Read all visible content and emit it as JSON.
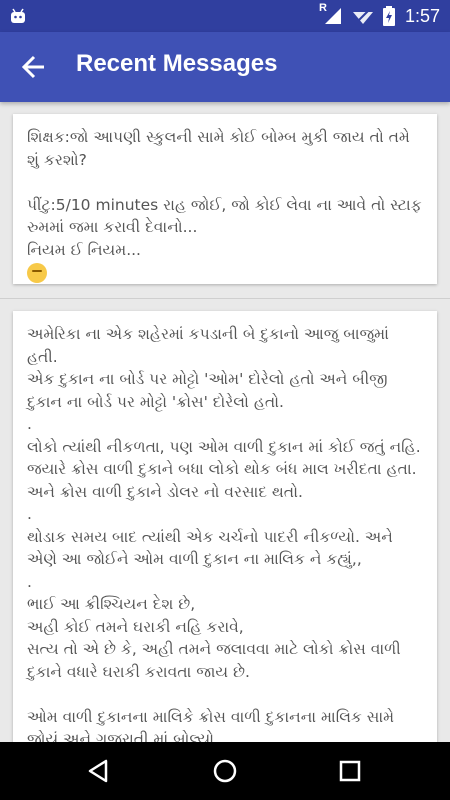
{
  "status_bar": {
    "time": "1:57",
    "roaming_indicator": "R",
    "icons": [
      "android-icon",
      "wifi-icon",
      "signal-icon",
      "battery-charging-icon"
    ]
  },
  "app_bar": {
    "title": "Recent Messages",
    "back_icon": "arrow-back-icon",
    "color": "#3f51b5",
    "status_color": "#303f9f"
  },
  "messages": [
    {
      "text": "શિક્ષક:જો આપણી સ્કુલની સામે કોઈ બોમ્બ મુકી જાય તો તમે શું કરશો?\n\nપીંટુ:5/10 minutes રાહ જોઈ, જો કોઈ લેવા ના આવે તો સ્ટાફ રુમમાં જમા કરાવી દેવાનો...\nનિયમ ઈ નિયમ...",
      "emoji": "face-emoji"
    },
    {
      "text": "અમેરિકા ના એક શહેરમાં કપડાની બે દુકાનો આજુ બાજુમાં હતી.\nએક દુકાન ના બોર્ડ પર મોટ્ટો 'ઓમ' દોરેલો હતો અને બીજી દુકાન ના બોર્ડ પર મોટ્ટો 'ક્રોસ' દોરેલો હતો.\n.\nલોકો ત્યાંથી નીકળતા, પણ ઓમ વાળી દુકાન માં કોઈ જતું નહિ.\nજયારે ક્રોસ વાળી દુકાને બધા લોકો થોક બંધ માલ ખરીદતા હતા.\nઅને ક્રોસ વાળી દુકાને ડોલર નો વરસાદ થતો.\n.\nથોડાક સમય બાદ ત્યાંથી એક ચર્ચનો પાદરી નીકળ્યો. અને એણે આ જોઈને ઓમ વાળી દુકાન ના માલિક ને કહ્યું,,\n.\nભાઈ આ ક્રીશ્ચિયન દેશ છે,\nઅહી કોઈ તમને ઘરાકી નહિ કરાવે,\nસત્ય તો એ છે કે, અહી તમને જલાવવા માટે લોકો ક્રોસ વાળી દુકાને વધારે ઘરાકી કરાવતા જાય છે.\n\nઓમ વાળી દુકાનના માલિકે ક્રોસ વાળી દુકાનના માલિક સામે જોયું અને ગુજરાતી માં બોલ્યો,,\nચિરાગભાઈ...??\nબોલો હિતેશભાઈ...!"
    }
  ],
  "nav_bar": {
    "buttons": [
      "back-triangle-icon",
      "home-circle-icon",
      "recents-square-icon"
    ]
  }
}
